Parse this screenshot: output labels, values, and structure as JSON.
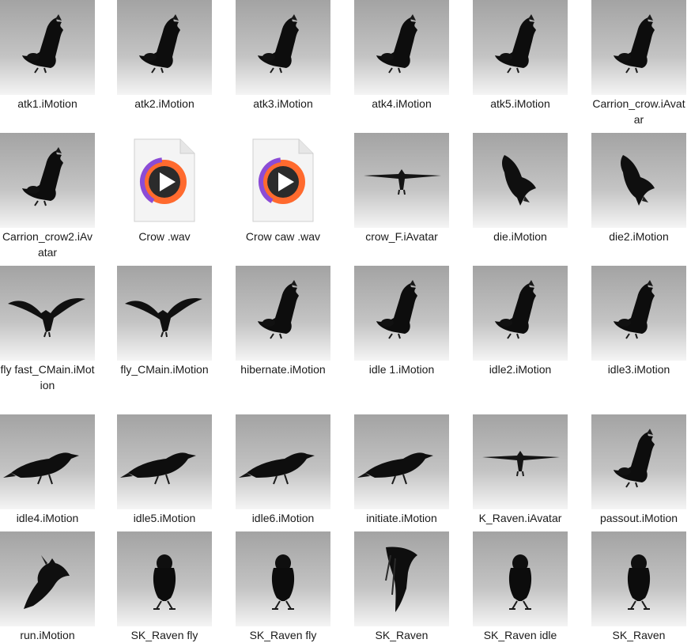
{
  "explorer": {
    "items": [
      {
        "name": "atk1.iMotion",
        "icon": "crow-raised-wings-icon",
        "type": "thumb"
      },
      {
        "name": "atk2.iMotion",
        "icon": "crow-raised-wings-icon",
        "type": "thumb"
      },
      {
        "name": "atk3.iMotion",
        "icon": "crow-raised-wings-icon",
        "type": "thumb"
      },
      {
        "name": "atk4.iMotion",
        "icon": "crow-raised-wings-icon",
        "type": "thumb"
      },
      {
        "name": "atk5.iMotion",
        "icon": "crow-raised-wings-icon",
        "type": "thumb"
      },
      {
        "name": "Carrion_crow.iAvatar",
        "icon": "crow-raised-wings-icon",
        "type": "thumb"
      },
      {
        "name": "Carrion_crow2.iAvatar",
        "icon": "crow-raised-wings-icon",
        "type": "thumb"
      },
      {
        "name": "Crow .wav",
        "icon": "audio-file-icon",
        "type": "audio"
      },
      {
        "name": "Crow caw .wav",
        "icon": "audio-file-icon",
        "type": "audio"
      },
      {
        "name": "crow_F.iAvatar",
        "icon": "crow-tpose-icon",
        "type": "thumb"
      },
      {
        "name": "die.iMotion",
        "icon": "crow-falling-icon",
        "type": "thumb"
      },
      {
        "name": "die2.iMotion",
        "icon": "crow-falling-icon",
        "type": "thumb"
      },
      {
        "name": "fly fast_CMain.iMotion",
        "icon": "crow-flying-front-icon",
        "type": "thumb"
      },
      {
        "name": "fly_CMain.iMotion",
        "icon": "crow-flying-front-icon",
        "type": "thumb"
      },
      {
        "name": "hibernate.iMotion",
        "icon": "crow-raised-wings-icon",
        "type": "thumb"
      },
      {
        "name": "idle 1.iMotion",
        "icon": "crow-raised-wings-icon",
        "type": "thumb"
      },
      {
        "name": "idle2.iMotion",
        "icon": "crow-raised-wings-icon",
        "type": "thumb"
      },
      {
        "name": "idle3.iMotion",
        "icon": "crow-raised-wings-icon",
        "type": "thumb"
      },
      {
        "name": "idle4.iMotion",
        "icon": "crow-side-icon",
        "type": "thumb"
      },
      {
        "name": "idle5.iMotion",
        "icon": "crow-side-icon",
        "type": "thumb"
      },
      {
        "name": "idle6.iMotion",
        "icon": "crow-side-icon",
        "type": "thumb"
      },
      {
        "name": "initiate.iMotion",
        "icon": "crow-side-icon",
        "type": "thumb"
      },
      {
        "name": "K_Raven.iAvatar",
        "icon": "crow-tpose-icon",
        "type": "thumb"
      },
      {
        "name": "passout.iMotion",
        "icon": "crow-raised-wings-icon",
        "type": "thumb"
      },
      {
        "name": "run.iMotion",
        "icon": "crow-running-icon",
        "type": "thumb"
      },
      {
        "name": "SK_Raven fly",
        "icon": "crow-standing-front-icon",
        "type": "thumb"
      },
      {
        "name": "SK_Raven fly",
        "icon": "crow-standing-front-icon",
        "type": "thumb"
      },
      {
        "name": "SK_Raven",
        "icon": "crow-hanging-icon",
        "type": "thumb"
      },
      {
        "name": "SK_Raven idle",
        "icon": "crow-standing-front-icon",
        "type": "thumb"
      },
      {
        "name": "SK_Raven",
        "icon": "crow-standing-front-icon",
        "type": "thumb"
      }
    ]
  }
}
